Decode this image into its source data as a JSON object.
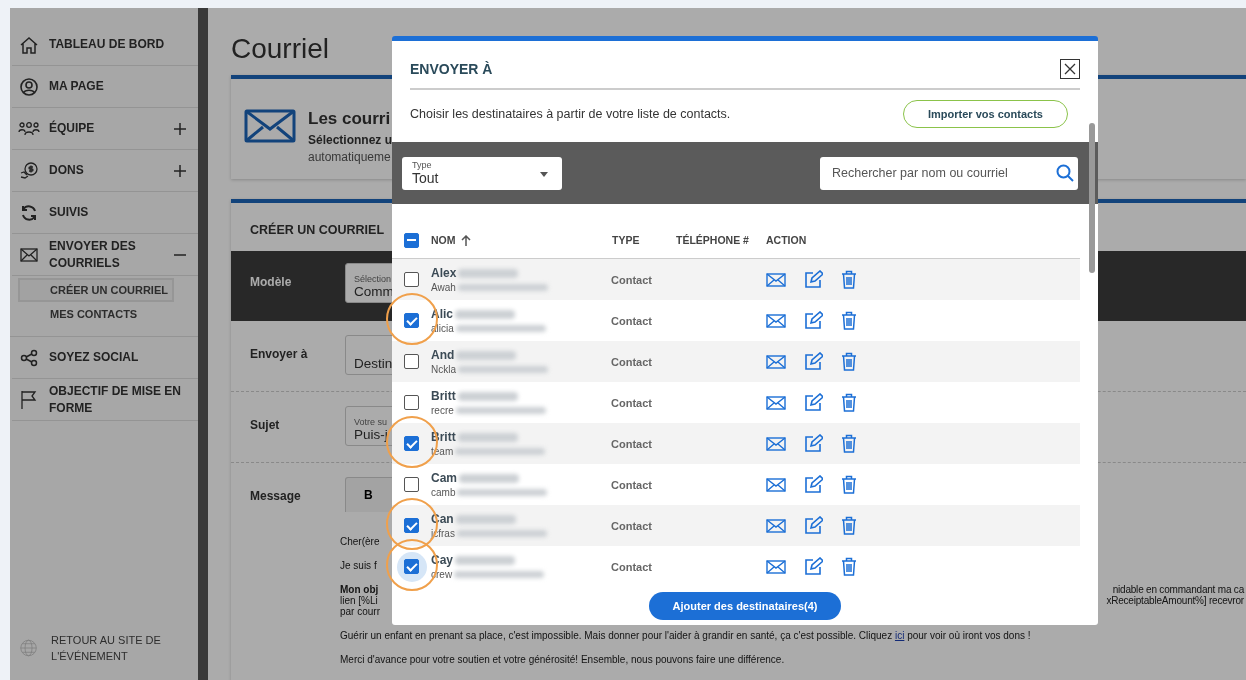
{
  "sidebar": {
    "items": [
      {
        "label": "TABLEAU DE BORD"
      },
      {
        "label": "MA PAGE"
      },
      {
        "label": "ÉQUIPE",
        "expanded": false
      },
      {
        "label": "DONS",
        "expanded": false
      },
      {
        "label": "SUIVIS"
      },
      {
        "label": "ENVOYER DES COURRIELS",
        "expanded": true,
        "children": [
          {
            "label": "CRÉER UN COURRIEL",
            "selected": true
          },
          {
            "label": "MES CONTACTS",
            "selected": false
          }
        ]
      },
      {
        "label": "SOYEZ SOCIAL"
      },
      {
        "label": "OBJECTIF DE MISE EN FORME"
      }
    ],
    "footer_link": "RETOUR AU SITE DE L'ÉVÉNEMENT"
  },
  "page": {
    "title": "Courriel",
    "info_card": {
      "heading": "Les courri",
      "line_1": "Sélectionnez u",
      "line_2": "automatiqueme"
    },
    "form": {
      "title": "CRÉER UN COURRIEL",
      "fields": [
        {
          "label": "Modèle",
          "floating_label": "Sélection",
          "value": "Comm",
          "dark": true
        },
        {
          "label": "Envoyer à",
          "value": "Destin",
          "dark": false
        },
        {
          "label": "Sujet",
          "floating_label": "Votre su",
          "value": "Puis-j",
          "dark": false
        }
      ],
      "message": {
        "label": "Message",
        "toolbar": [
          "B"
        ],
        "paragraphs": [
          {
            "lines": [
              {
                "left": "Cher(ère"
              }
            ]
          },
          {
            "lines": [
              {
                "left": "Je suis f"
              }
            ]
          },
          {
            "lines": [
              {
                "left": "**Mon obj**",
                "right": "nidable en commandant ma ca"
              },
              {
                "left": "lien [%Li",
                "right": "xReceiptableAmount%] recevror"
              },
              {
                "left": "par courr"
              }
            ]
          },
          {
            "lines": [
              {
                "left": "Guérir un enfant en prenant sa place, c'est impossible. Mais donner pour l'aider à grandir en santé, ça c'est possible. Cliquez ",
                "link": "ici",
                "after": " pour voir où iront vos dons !"
              }
            ]
          },
          {
            "lines": [
              {
                "left": "Merci d'avance pour votre soutien et votre générosité! Ensemble, nous pouvons faire une différence."
              }
            ]
          }
        ]
      }
    }
  },
  "modal": {
    "title": "ENVOYER À",
    "description": "Choisir les destinataires à partir de votre liste de contacts.",
    "import_button": "Importer vos contacts",
    "type_select": {
      "label": "Type",
      "value": "Tout"
    },
    "search": {
      "placeholder": "Rechercher par nom ou courriel"
    },
    "table": {
      "select_all": {
        "indeterminate": true
      },
      "columns": [
        {
          "label": "NOM",
          "sorted": true
        },
        {
          "label": "TYPE",
          "sorted": false
        },
        {
          "label": "TÉLÉPHONE #",
          "sorted": false
        },
        {
          "label": "ACTION",
          "sorted": false
        }
      ],
      "rows": [
        {
          "name": "Alex",
          "email": "Awah",
          "type": "Contact",
          "checked": false,
          "focused": false
        },
        {
          "name": "Alic",
          "email": "alicia",
          "type": "Contact",
          "checked": true,
          "focused": false
        },
        {
          "name": "And",
          "email": "Nckla",
          "type": "Contact",
          "checked": false,
          "focused": false
        },
        {
          "name": "Britt",
          "email": "recre",
          "type": "Contact",
          "checked": false,
          "focused": false
        },
        {
          "name": "Britt",
          "email": "team",
          "type": "Contact",
          "checked": true,
          "focused": false
        },
        {
          "name": "Cam",
          "email": "camb",
          "type": "Contact",
          "checked": false,
          "focused": false
        },
        {
          "name": "Can",
          "email": "jcfras",
          "type": "Contact",
          "checked": true,
          "focused": false
        },
        {
          "name": "Cay",
          "email": "crew",
          "type": "Contact",
          "checked": true,
          "focused": true
        }
      ]
    },
    "add_button": "Ajouter des destinataires(4)"
  }
}
